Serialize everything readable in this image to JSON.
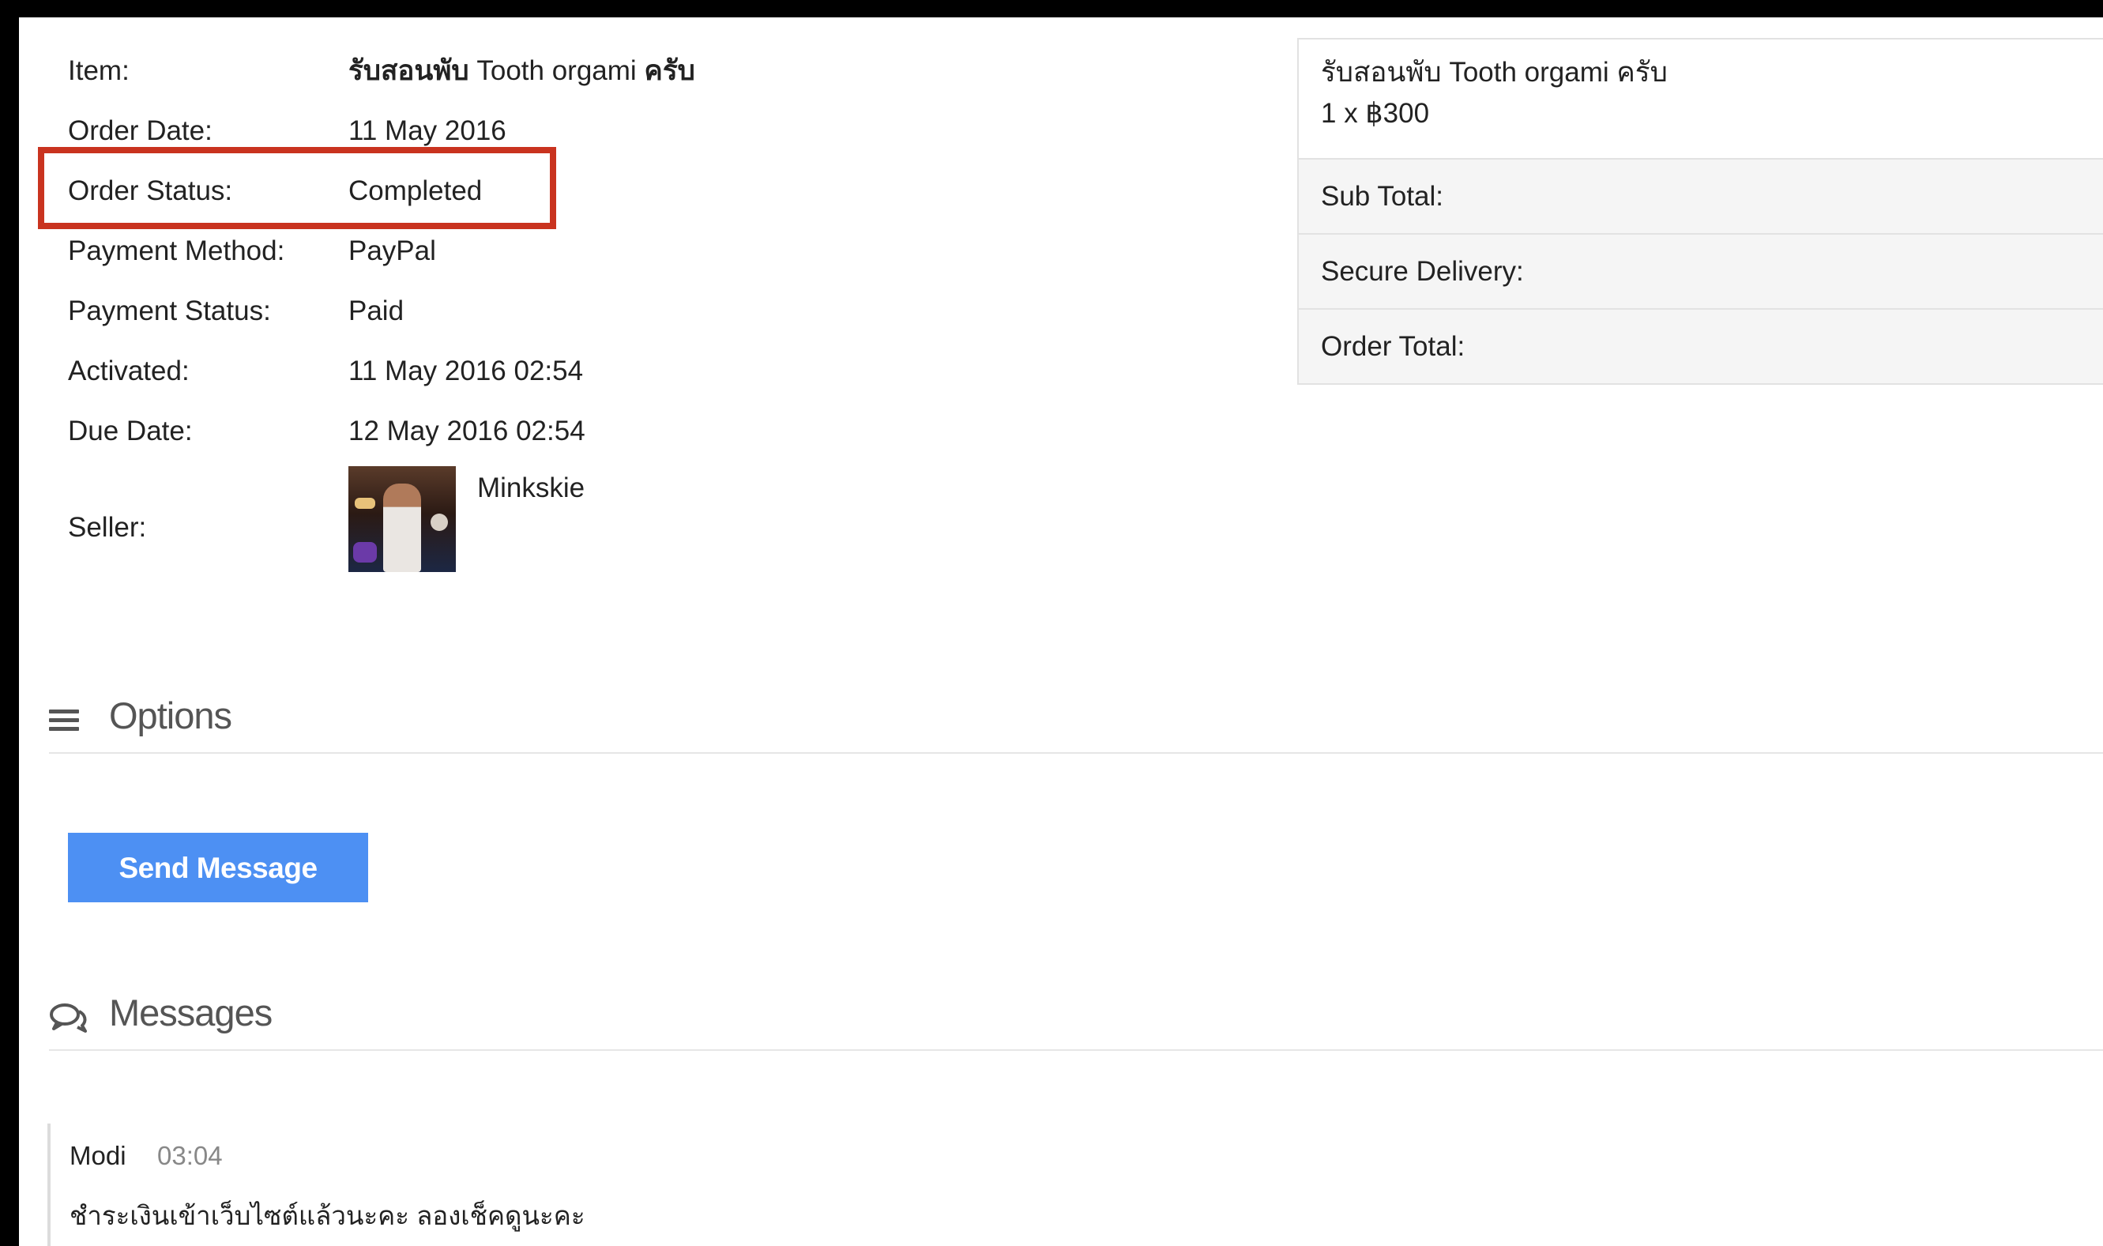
{
  "order": {
    "rows": [
      {
        "label": "Item:",
        "value_bold_prefix": "รับสอนพับ",
        "value_middle": " Tooth orgami ",
        "value_bold_suffix": "ครับ"
      },
      {
        "label": "Order Date:",
        "value": "11 May 2016"
      },
      {
        "label": "Order Status:",
        "value": "Completed"
      },
      {
        "label": "Payment Method:",
        "value": "PayPal"
      },
      {
        "label": "Payment Status:",
        "value": "Paid"
      },
      {
        "label": "Activated:",
        "value": "11 May 2016 02:54"
      },
      {
        "label": "Due Date:",
        "value": "12 May 2016 02:54"
      }
    ],
    "seller_label": "Seller:",
    "seller_name": "Minkskie"
  },
  "summary": {
    "item_name": "รับสอนพับ Tooth orgami ครับ",
    "item_qty": "1 x ฿300",
    "sub_total_label": "Sub Total:",
    "secure_delivery_label": "Secure Delivery:",
    "order_total_label": "Order Total:"
  },
  "options": {
    "title": "Options",
    "send_message_label": "Send Message"
  },
  "messages": {
    "title": "Messages",
    "items": [
      {
        "author": "Modi",
        "time": "03:04",
        "text": "ชำระเงินเข้าเว็บไซต์แล้วนะคะ ลองเช็คดูนะคะ"
      }
    ]
  },
  "colors": {
    "highlight": "#c9331f",
    "button": "#4d90f3"
  }
}
